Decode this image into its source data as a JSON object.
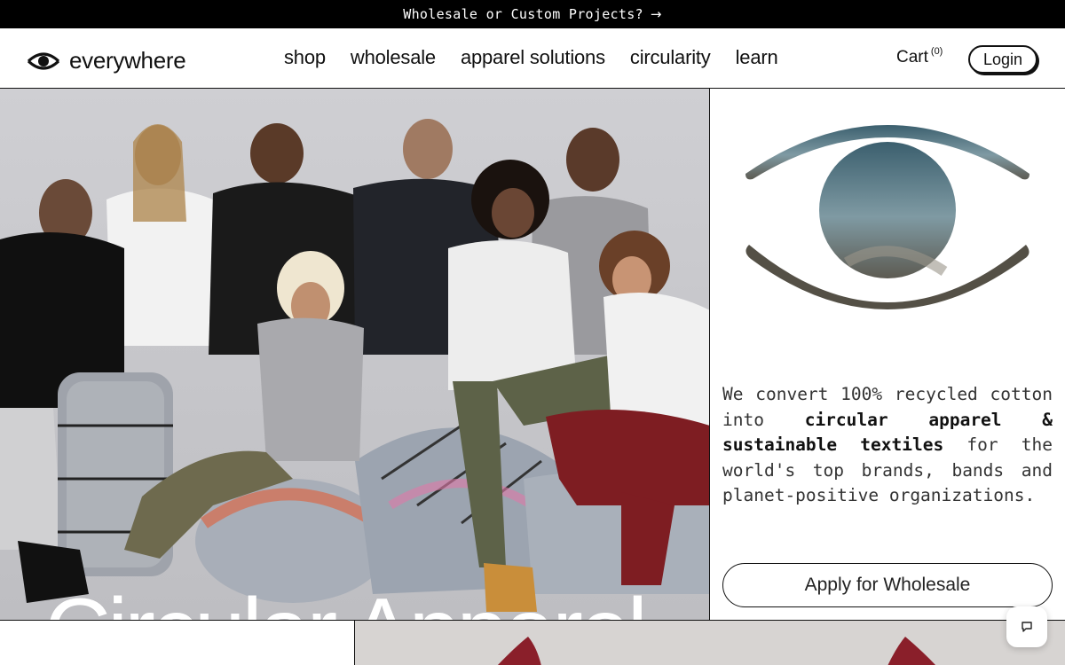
{
  "announcement": {
    "text": "Wholesale or Custom Projects?",
    "arrow": "→"
  },
  "brand": {
    "name": "everywhere"
  },
  "nav": {
    "items": [
      {
        "label": "shop"
      },
      {
        "label": "wholesale"
      },
      {
        "label": "apparel solutions"
      },
      {
        "label": "circularity"
      },
      {
        "label": "learn"
      }
    ]
  },
  "cart": {
    "label": "Cart",
    "count": "(0)"
  },
  "login": {
    "label": "Login"
  },
  "hero": {
    "title": "Circular Apparel"
  },
  "side": {
    "desc_1": "We convert 100% recycled cotton into ",
    "desc_bold": "circular apparel & sustainable textiles",
    "desc_2": " for the world's top brands, bands and planet-positive organizations.",
    "cta": "Apply for Wholesale"
  },
  "icons": {
    "logo": "eye-logo-icon",
    "arrow": "arrow-right-icon",
    "chat": "chat-bubble-icon"
  },
  "colors": {
    "accent": "#000000",
    "background": "#ffffff",
    "hero_bg": "#c9c9cd"
  }
}
